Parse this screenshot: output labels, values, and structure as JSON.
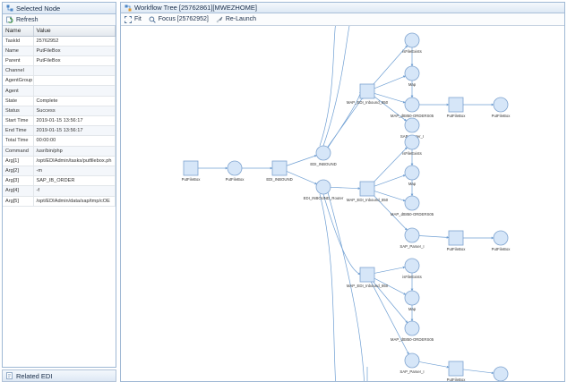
{
  "left_panel": {
    "title": "Selected Node",
    "refresh_label": "Refresh",
    "columns": [
      "Name",
      "Value"
    ],
    "rows": [
      {
        "name": "TaskId",
        "value": "25762952"
      },
      {
        "name": "Name",
        "value": "PutFileBox"
      },
      {
        "name": "Parent",
        "value": "PutFileBox"
      },
      {
        "name": "Channel",
        "value": ""
      },
      {
        "name": "AgentGroup",
        "value": ""
      },
      {
        "name": "Agent",
        "value": ""
      },
      {
        "name": "State",
        "value": "Complete"
      },
      {
        "name": "Status",
        "value": "Success"
      },
      {
        "name": "Start Time",
        "value": "2019-01-15 13:56:17"
      },
      {
        "name": "End Time",
        "value": "2019-01-15 13:56:17"
      },
      {
        "name": "Total Time",
        "value": "00:00:00"
      },
      {
        "name": "Command",
        "value": "/usr/bin/php"
      },
      {
        "name": "Arg[1]",
        "value": "/opt/EDIAdmin/tasks/putfilebox.ph"
      },
      {
        "name": "Arg[2]",
        "value": "-m"
      },
      {
        "name": "Arg[3]",
        "value": "SAP_IB_ORDER"
      },
      {
        "name": "Arg[4]",
        "value": "-f"
      },
      {
        "name": "Arg[5]",
        "value": "/opt/EDIAdmin/data/sap/tmp/cOE"
      }
    ],
    "related_label": "Related EDI"
  },
  "right_panel": {
    "title": "Workflow Tree [25762861][MWEZHOME]",
    "fit_label": "Fit",
    "focus_label": "Focus [25762952]",
    "relaunch_label": "Re-Launch"
  },
  "graph": {
    "labels": {
      "putfilebox_1": "PutFileBox",
      "putfilebox_2": "PutFileBox",
      "edi_inbound_sq": "EDI_INBOUND",
      "edi_inbound_circ": "EDI_INBOUND",
      "edi_inbound_router": "EDI_INBOUND_Router",
      "ifexists_a": "isFileExists",
      "map_a": "Map",
      "map_sq_a": "MAP_EDI_Inbound_850",
      "desadv_a": "MAP_dtt850-ORDERS05",
      "sap_porter_a": "SAP_Porter_I",
      "putfilebox_a": "PutFileBox",
      "putfilebox_a2": "PutFileBox",
      "ifexists_b": "isFileExists",
      "map_b": "Map",
      "map_sq_b": "MAP_EDI_Inbound_850",
      "desadv_b": "MAP_dtt850-ORDERS05",
      "sap_porter_b": "SAP_Parser_I",
      "putfilebox_b": "PutFileBox",
      "putfilebox_b2": "PutFileBox",
      "ifexists_c": "isFileExists",
      "map_c": "Map",
      "map_sq_c": "MAP_EDI_Inbound_850",
      "desadv_c": "MAP_dtt850-ORDERS05",
      "sap_porter_c": "SAP_Parser_I",
      "putfilebox_c": "PutFileBox",
      "putfilebox_c2": "PutFileBox"
    }
  },
  "colors": {
    "node_fill": "#d6e6f8",
    "node_stroke": "#7ea3cf",
    "edge": "#6f9fd3",
    "header_text": "#1a2e4a"
  },
  "icons": {
    "header_left": "tree-icon",
    "refresh": "refresh-icon",
    "header_right": "workflow-icon",
    "fit": "fit-icon",
    "focus": "focus-icon",
    "relaunch": "relaunch-icon",
    "related": "related-icon"
  }
}
